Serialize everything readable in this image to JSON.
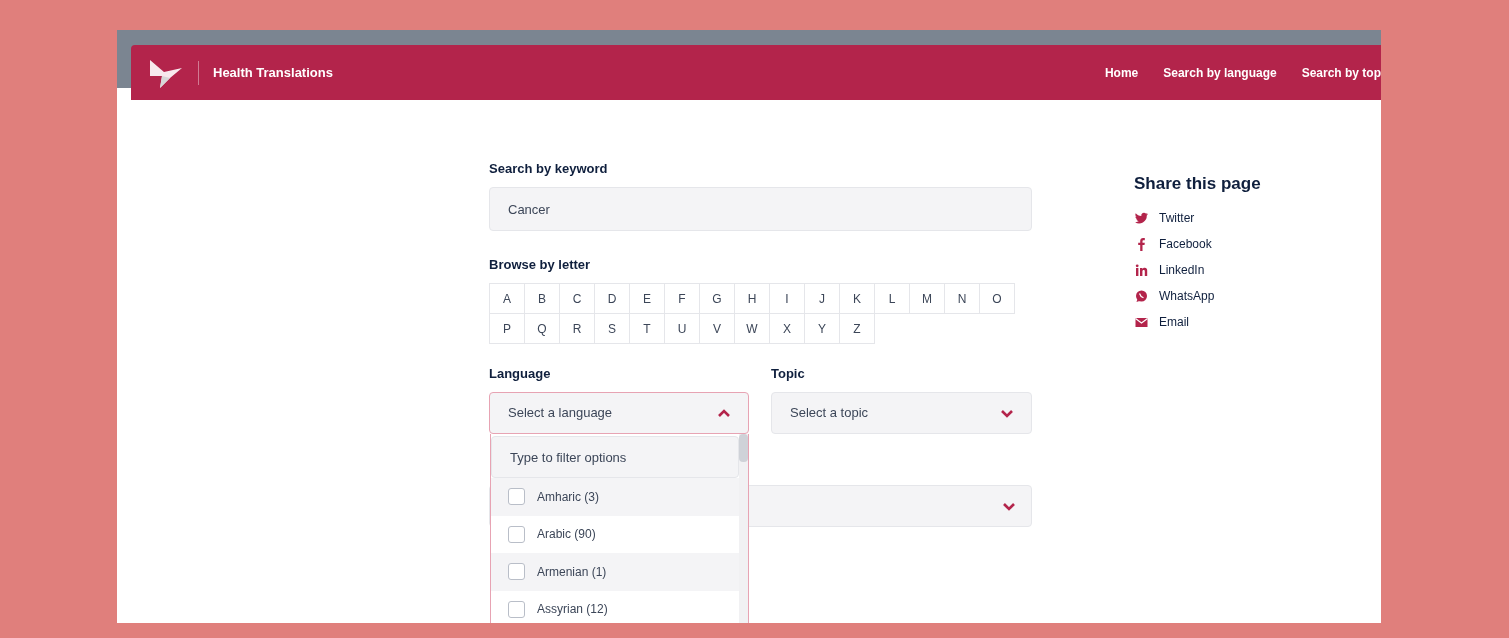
{
  "header": {
    "title": "Health Translations",
    "nav": [
      {
        "label": "Home"
      },
      {
        "label": "Search by language"
      },
      {
        "label": "Search by top"
      }
    ]
  },
  "keyword": {
    "label": "Search by keyword",
    "value": "Cancer"
  },
  "letters": {
    "label": "Browse by letter",
    "items": [
      "A",
      "B",
      "C",
      "D",
      "E",
      "F",
      "G",
      "H",
      "I",
      "J",
      "K",
      "L",
      "M",
      "N",
      "O",
      "P",
      "Q",
      "R",
      "S",
      "T",
      "U",
      "V",
      "W",
      "X",
      "Y",
      "Z"
    ]
  },
  "language": {
    "label": "Language",
    "placeholder": "Select a language",
    "expanded": true,
    "filter_placeholder": "Type to filter options",
    "options": [
      {
        "label": "Amharic (3)",
        "checked": false
      },
      {
        "label": "Arabic (90)",
        "checked": false
      },
      {
        "label": "Armenian (1)",
        "checked": false
      },
      {
        "label": "Assyrian (12)",
        "checked": false
      }
    ]
  },
  "topic": {
    "label": "Topic",
    "placeholder": "Select a topic",
    "expanded": false
  },
  "third_select": {
    "expanded": false
  },
  "share": {
    "title": "Share this page",
    "items": [
      {
        "kind": "twitter",
        "label": "Twitter"
      },
      {
        "kind": "facebook",
        "label": "Facebook"
      },
      {
        "kind": "linkedin",
        "label": "LinkedIn"
      },
      {
        "kind": "whatsapp",
        "label": "WhatsApp"
      },
      {
        "kind": "email",
        "label": "Email"
      }
    ]
  }
}
